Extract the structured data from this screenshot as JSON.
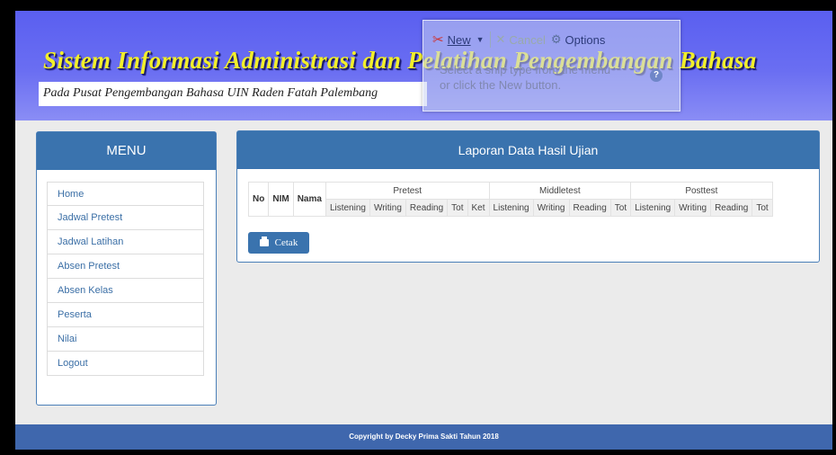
{
  "header": {
    "title": "Sistem Informasi Administrasi dan Pelatihan Pengembangan Bahasa",
    "subtitle": "Pada Pusat Pengembangan Bahasa UIN Raden  Fatah Palembang"
  },
  "snipping_tool": {
    "new_label": "New",
    "cancel_label": "Cancel",
    "options_label": "Options",
    "message_line1": "Select a snip type from the menu",
    "message_line2": "or click the New button.",
    "help_label": "?"
  },
  "menu": {
    "title": "MENU",
    "items": [
      {
        "label": "Home"
      },
      {
        "label": "Jadwal Pretest"
      },
      {
        "label": "Jadwal Latihan"
      },
      {
        "label": "Absen Pretest"
      },
      {
        "label": "Absen Kelas"
      },
      {
        "label": "Peserta"
      },
      {
        "label": "Nilai"
      },
      {
        "label": "Logout"
      }
    ]
  },
  "report": {
    "title": "Laporan Data Hasil Ujian",
    "columns": {
      "no": "No",
      "nim": "NIM",
      "nama": "Nama",
      "groups": [
        {
          "label": "Pretest",
          "subs": [
            "Listening",
            "Writing",
            "Reading",
            "Tot",
            "Ket"
          ]
        },
        {
          "label": "Middletest",
          "subs": [
            "Listening",
            "Writing",
            "Reading",
            "Tot"
          ]
        },
        {
          "label": "Posttest",
          "subs": [
            "Listening",
            "Writing",
            "Reading",
            "Tot"
          ]
        }
      ]
    },
    "print_button": "Cetak"
  },
  "footer": {
    "text": "Copyright by Decky Prima Sakti Tahun 2018"
  },
  "colors": {
    "header_bg": "#5a5ff0",
    "title_yellow": "#f2ef2a",
    "panel_blue": "#3a73ae",
    "footer_bg": "#3f67ad",
    "content_bg": "#ebebeb"
  }
}
